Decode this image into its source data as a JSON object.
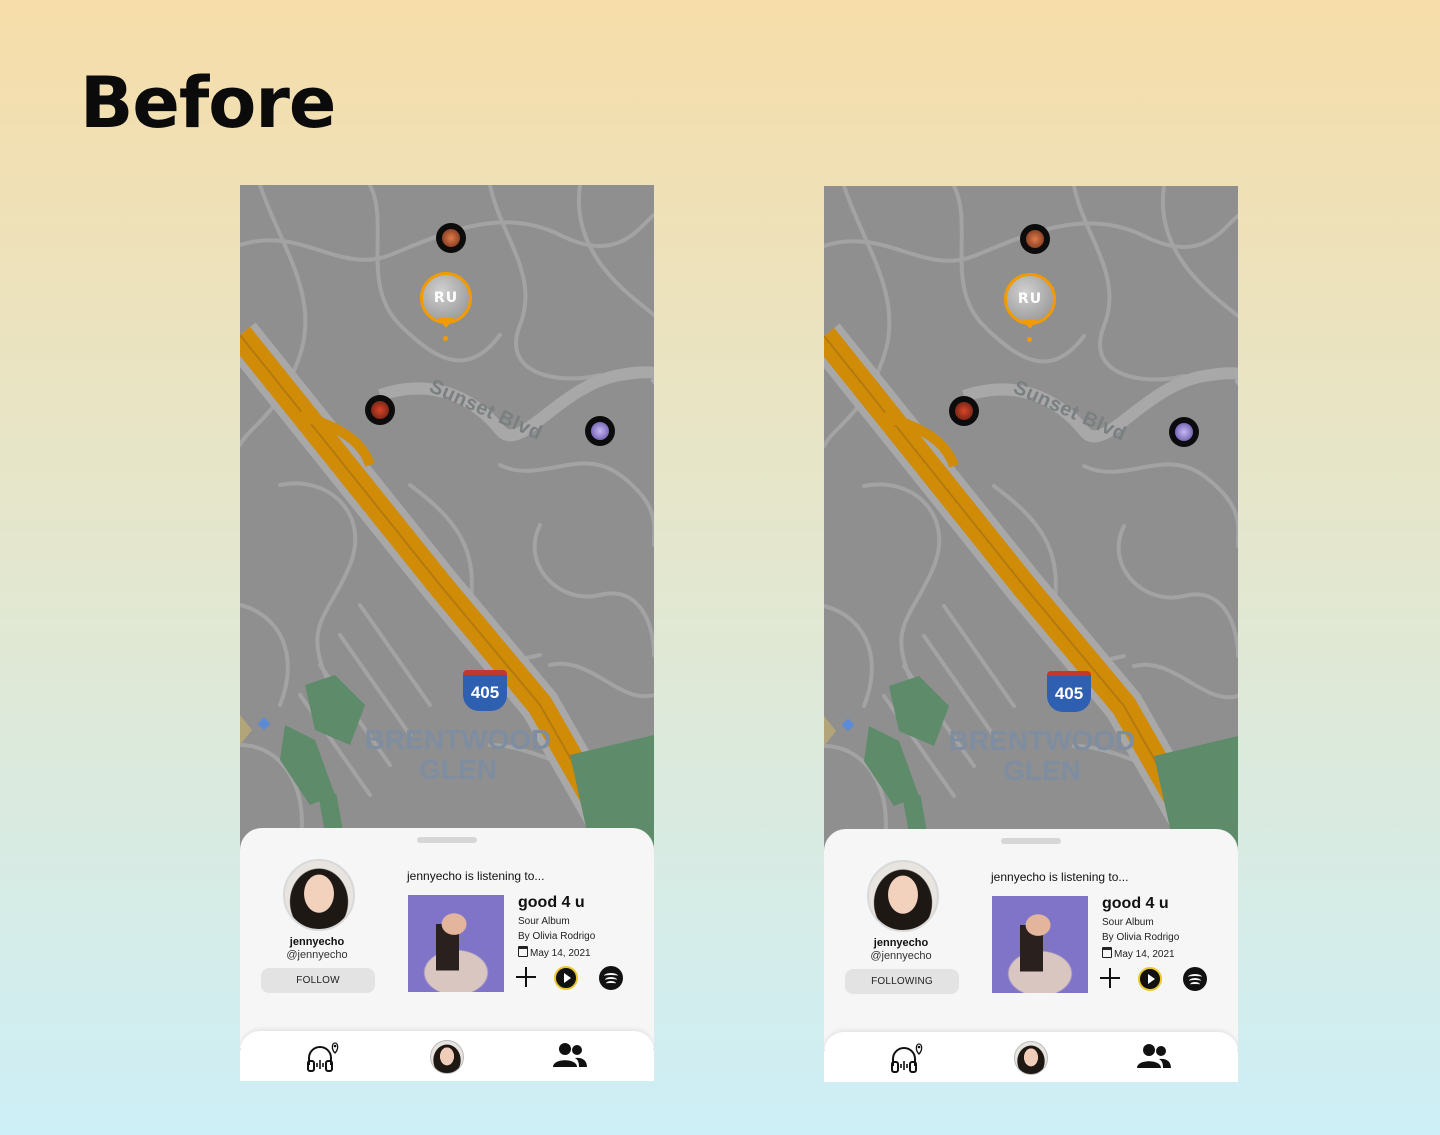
{
  "page": {
    "title": "Before"
  },
  "screens": [
    {
      "map": {
        "street_label": "Sunset Blvd",
        "highway_shield": "405",
        "area_label_line1": "BRENTWOOD",
        "area_label_line2": "GLEN"
      },
      "user_pin": {
        "initials": "RU",
        "color": "#f29b00"
      },
      "profile": {
        "username": "jennyecho",
        "handle": "@jennyecho",
        "follow_label": "FOLLOW"
      },
      "now_playing": {
        "heading": "jennyecho is listening to...",
        "song": "good 4 u",
        "album": "Sour Album",
        "artist": "By Olivia Rodrigo",
        "date": "May 14, 2021"
      },
      "icons": [
        "plus-icon",
        "play-icon",
        "spotify-icon",
        "headphones-map-icon",
        "avatar",
        "friends-icon"
      ]
    },
    {
      "map": {
        "street_label": "Sunset Blvd",
        "highway_shield": "405",
        "area_label_line1": "BRENTWOOD",
        "area_label_line2": "GLEN"
      },
      "user_pin": {
        "initials": "RU",
        "color": "#f29b00"
      },
      "profile": {
        "username": "jennyecho",
        "handle": "@jennyecho",
        "follow_label": "FOLLOWING"
      },
      "now_playing": {
        "heading": "jennyecho is listening to...",
        "song": "good 4 u",
        "album": "Sour Album",
        "artist": "By Olivia Rodrigo",
        "date": "May 14, 2021"
      },
      "icons": [
        "plus-icon",
        "play-icon",
        "spotify-icon",
        "headphones-map-icon",
        "avatar",
        "friends-icon"
      ]
    }
  ]
}
